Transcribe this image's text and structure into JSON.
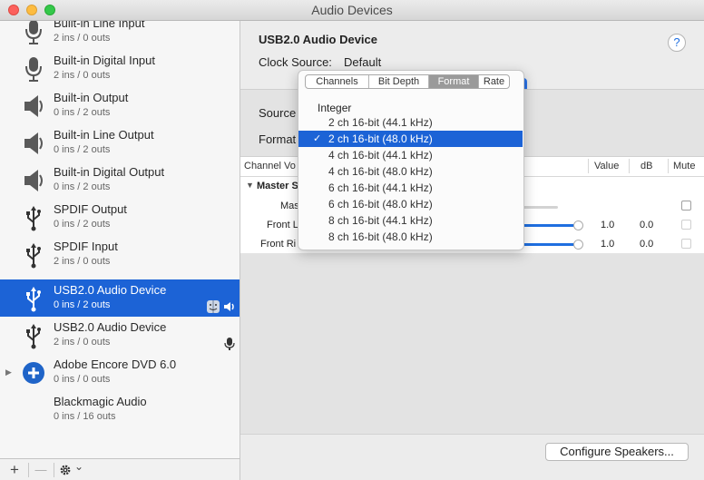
{
  "window": {
    "title": "Audio Devices"
  },
  "sidebar": {
    "devices": [
      {
        "name": "Built-in Line Input",
        "io": "2 ins / 0 outs",
        "icon": "microphone-icon"
      },
      {
        "name": "Built-in Digital Input",
        "io": "2 ins / 0 outs",
        "icon": "microphone-icon"
      },
      {
        "name": "Built-in Output",
        "io": "0 ins / 2 outs",
        "icon": "speaker-icon"
      },
      {
        "name": "Built-in Line Output",
        "io": "0 ins / 2 outs",
        "icon": "speaker-icon"
      },
      {
        "name": "Built-in Digital Output",
        "io": "0 ins / 2 outs",
        "icon": "speaker-icon"
      },
      {
        "name": "SPDIF Output",
        "io": "0 ins / 2 outs",
        "icon": "usb-icon"
      },
      {
        "name": "SPDIF Input",
        "io": "2 ins / 0 outs",
        "icon": "usb-icon"
      },
      {
        "name": "USB2.0 Audio Device",
        "io": "0 ins / 2 outs",
        "icon": "usb-icon",
        "selected": true
      },
      {
        "name": "USB2.0 Audio Device",
        "io": "2 ins / 0 outs",
        "icon": "usb-icon"
      },
      {
        "name": "Adobe Encore DVD 6.0",
        "io": "0 ins / 0 outs",
        "icon": "plus-circle-icon"
      },
      {
        "name": "Blackmagic Audio",
        "io": "0 ins / 16 outs",
        "icon": "none"
      }
    ],
    "toolbar": {
      "add": "+",
      "remove": "—",
      "gear_chevron": "⌄"
    }
  },
  "main": {
    "device_title": "USB2.0 Audio Device",
    "help": "?",
    "clock_source_label": "Clock Source:",
    "clock_source_value": "Default",
    "source_label": "Source",
    "format_label": "Format",
    "table": {
      "col_channel": "Channel Vo",
      "col_value": "Value",
      "col_db": "dB",
      "col_mute": "Mute",
      "group": "Master S",
      "rows": [
        {
          "label": "Mas",
          "value": "",
          "db": ""
        },
        {
          "label": "Front L",
          "value": "1.0",
          "db": "0.0"
        },
        {
          "label": "Front Ri",
          "value": "1.0",
          "db": "0.0"
        }
      ]
    },
    "configure_button": "Configure Speakers..."
  },
  "popover": {
    "tabs": [
      "Channels",
      "Bit Depth",
      "Format",
      "Rate"
    ],
    "active_tab": "Format",
    "heading": "Integer",
    "options": [
      "2 ch 16-bit (44.1 kHz)",
      "2 ch 16-bit (48.0 kHz)",
      "4 ch 16-bit (44.1 kHz)",
      "4 ch 16-bit (48.0 kHz)",
      "6 ch 16-bit (44.1 kHz)",
      "6 ch 16-bit (48.0 kHz)",
      "8 ch 16-bit (44.1 kHz)",
      "8 ch 16-bit (48.0 kHz)"
    ],
    "selected_index": 1,
    "check_glyph": "✓"
  },
  "colors": {
    "selection": "#1c63d6",
    "accent": "#1f6fe0"
  }
}
